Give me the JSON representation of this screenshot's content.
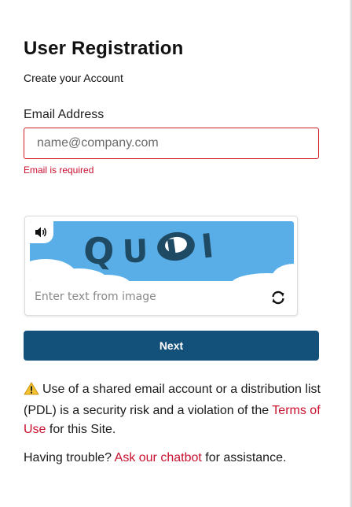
{
  "form": {
    "title": "User Registration",
    "subtitle": "Create your Account",
    "email_label": "Email Address",
    "email_placeholder": "name@company.com",
    "email_value": "",
    "email_error": "Email is required"
  },
  "captcha": {
    "image_text": "QUPI",
    "input_placeholder": "Enter text from image",
    "input_value": "",
    "audio_icon": "speaker-icon",
    "refresh_icon": "refresh-icon"
  },
  "actions": {
    "next_label": "Next"
  },
  "notice": {
    "warning_icon": "warning-icon",
    "warning_before": "Use of a shared email account or a distribution list (PDL) is a security risk and a violation of the ",
    "terms_link": "Terms of Use",
    "warning_after": " for this Site.",
    "help_before": "Having trouble? ",
    "chatbot_link": "Ask our chatbot",
    "help_after": " for assistance."
  },
  "colors": {
    "primary": "#13507a",
    "error": "#c8102e",
    "captcha_sky": "#5aaee8"
  }
}
